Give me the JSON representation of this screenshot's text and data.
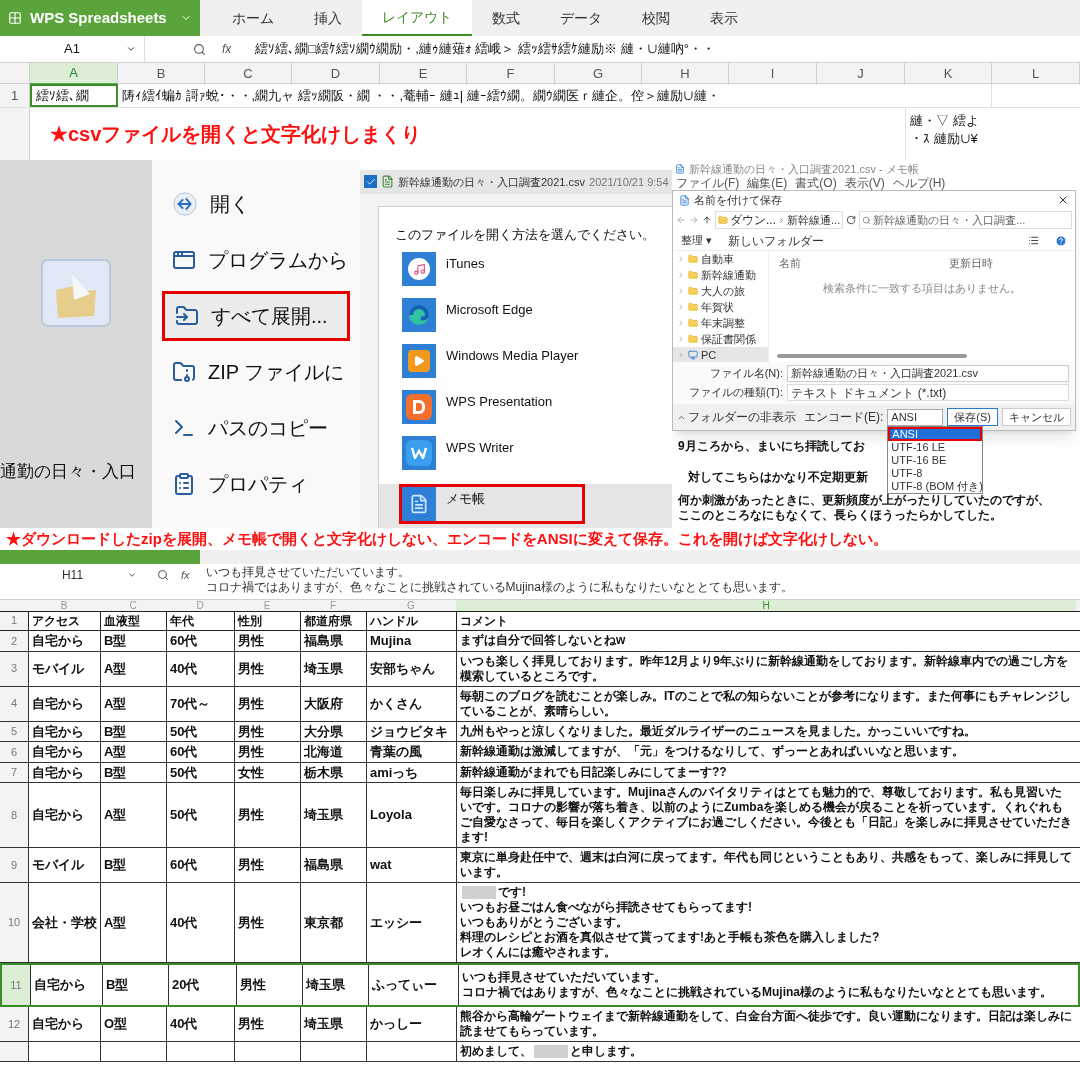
{
  "top_sheet": {
    "app_name": "WPS Spreadsheets",
    "tabs": [
      {
        "label": "ホーム",
        "selected": false
      },
      {
        "label": "挿入",
        "selected": false
      },
      {
        "label": "レイアウト",
        "selected": true
      },
      {
        "label": "数式",
        "selected": false
      },
      {
        "label": "データ",
        "selected": false
      },
      {
        "label": "校閲",
        "selected": false
      },
      {
        "label": "表示",
        "selected": false
      }
    ],
    "name_box": "A1",
    "fx": "fx",
    "formula": "繧ｿ繧､繝□繧ｹ繧ｿ繝ｳ繝励・,縺ｩ縺薙ｫ 繧峨＞ 繧ｯ繧ｻ繧ｹ縺励※ 縺・∪縺吶°・・",
    "columns": [
      {
        "label": "A",
        "selected": true
      },
      {
        "label": "B",
        "selected": false
      },
      {
        "label": "C",
        "selected": false
      },
      {
        "label": "D",
        "selected": false
      },
      {
        "label": "E",
        "selected": false
      },
      {
        "label": "F",
        "selected": false
      },
      {
        "label": "G",
        "selected": false
      },
      {
        "label": "H",
        "selected": false
      },
      {
        "label": "I",
        "selected": false
      },
      {
        "label": "J",
        "selected": false
      },
      {
        "label": "K",
        "selected": false
      },
      {
        "label": "L",
        "selected": false
      }
    ],
    "row_number": "1",
    "cell_a1": "繧ｿ繧､繝",
    "cell_b1": "陦ｨ繧ｲ蝙ｶ 謌ｧ蛻･・・,繝九ャ 繧ｯ繝阪・繝 ・・,菴輔ｰ 縺ｭ| 縺ｰ繧ｳ繝。繝ｳ繝医ｒ縺企。倥＞縺励∪縺・",
    "cell_l": [
      "縺・▽ 繧よ",
      "・ｽ 縺励∪¥"
    ],
    "caption": "★csvファイルを開くと文字化けしまくり"
  },
  "explorer": {
    "file_label": "通勤の日々・入口",
    "menu": [
      {
        "label": "開く",
        "selected": false
      },
      {
        "label": "プログラムから",
        "selected": false
      },
      {
        "label": "すべて展開...",
        "selected": true
      },
      {
        "label": "ZIP ファイルに",
        "selected": false
      },
      {
        "label": "パスのコピー",
        "selected": false
      },
      {
        "label": "プロパティ",
        "selected": false
      }
    ]
  },
  "open_with": {
    "file_checked": true,
    "file_name": "新幹線通勤の日々・入口調査2021.csv",
    "file_date": "2021/10/21 9:54",
    "title": "このファイルを開く方法を選んでください。",
    "apps": [
      {
        "label": "iTunes",
        "selected": false
      },
      {
        "label": "Microsoft Edge",
        "selected": false
      },
      {
        "label": "Windows Media Player",
        "selected": false
      },
      {
        "label": "WPS Presentation",
        "selected": false
      },
      {
        "label": "WPS Writer",
        "selected": false
      },
      {
        "label": "メモ帳",
        "selected": true
      }
    ]
  },
  "notepad": {
    "title": "新幹線通勤の日々・入口調査2021.csv - メモ帳",
    "menu": [
      "ファイル(F)",
      "編集(E)",
      "書式(O)",
      "表示(V)",
      "ヘルプ(H)"
    ],
    "save_dialog": {
      "title": "名前を付けて保存",
      "path": [
        "ダウン...",
        "新幹線通..."
      ],
      "search_placeholder": "新幹線通勤の日々・入口調査...",
      "organize": "整理 ▾",
      "new_folder": "新しいフォルダー",
      "tree": [
        {
          "label": "自動車",
          "kind": "folder",
          "selected": false
        },
        {
          "label": "新幹線通勤",
          "kind": "folder",
          "selected": false
        },
        {
          "label": "大人の旅",
          "kind": "folder",
          "selected": false
        },
        {
          "label": "年賀状",
          "kind": "folder",
          "selected": false
        },
        {
          "label": "年末調整",
          "kind": "folder",
          "selected": false
        },
        {
          "label": "保証書関係",
          "kind": "folder",
          "selected": false
        },
        {
          "label": "PC",
          "kind": "pc",
          "selected": true
        }
      ],
      "columns": [
        "名前",
        "更新日時"
      ],
      "empty_message": "検索条件に一致する項目はありません。",
      "file_name_label": "ファイル名(N):",
      "file_name": "新幹線通勤の日々・入口調査2021.csv",
      "file_type_label": "ファイルの種類(T):",
      "file_type": "テキスト ドキュメント (*.txt)",
      "hide_folders": "フォルダーの非表示",
      "encoding_label": "エンコード(E):",
      "encoding": "ANSI",
      "save": "保存(S)",
      "cancel": "キャンセル",
      "encoding_options": [
        {
          "label": "ANSI",
          "selected": true
        },
        {
          "label": "UTF-16 LE",
          "selected": false
        },
        {
          "label": "UTF-16 BE",
          "selected": false
        },
        {
          "label": "UTF-8",
          "selected": false
        },
        {
          "label": "UTF-8 (BOM 付き)",
          "selected": false
        }
      ]
    },
    "body_lines": [
      "9月ころから、まいにち拝読してお",
      "対してこちらはかなり不定期更新",
      "何か刺激があったときに、更新頻度が上がったりしていたのですが、",
      "ここのところなにもなくて、長らくほうったらかしてした。"
    ]
  },
  "caption": "★ダウンロードしたzipを展開、メモ帳で開くと文字化けしない、エンコードをANSIに変えて保存。これを開けば文字化けしない。",
  "bottom_sheet": {
    "name_box": "H11",
    "fx": "fx",
    "formula": [
      "いつも拝見させていただいています。",
      "コロナ禍ではありますが、色々なことに挑戦されているMujina様のように私もなりたいなととても思います。"
    ],
    "columns": [
      {
        "label": "B",
        "selected": false
      },
      {
        "label": "C",
        "selected": false
      },
      {
        "label": "D",
        "selected": false
      },
      {
        "label": "E",
        "selected": false
      },
      {
        "label": "F",
        "selected": false
      },
      {
        "label": "G",
        "selected": false
      },
      {
        "label": "H",
        "selected": true
      }
    ],
    "header": {
      "number": "1",
      "cells": [
        "アクセス",
        "血液型",
        "年代",
        "性別",
        "都道府県",
        "ハンドル",
        "コメント"
      ]
    },
    "rows": [
      {
        "number": "2",
        "selected": false,
        "cells": [
          "自宅から",
          "B型",
          "60代",
          "男性",
          "福島県",
          "Mujina"
        ],
        "comment": [
          "まずは自分で回答しないとねw"
        ]
      },
      {
        "number": "3",
        "selected": false,
        "cells": [
          "モバイル",
          "A型",
          "40代",
          "男性",
          "埼玉県",
          "安部ちゃん"
        ],
        "comment": [
          "いつも楽しく拝見しております。昨年12月より9年ぶりに新幹線通勤をしております。新幹線車内での過ごし方を模索しているところです。"
        ]
      },
      {
        "number": "4",
        "selected": false,
        "cells": [
          "自宅から",
          "A型",
          "70代～",
          "男性",
          "大阪府",
          "かくさん"
        ],
        "comment": [
          "毎朝このブログを読むことが楽しみ。ITのことで私の知らないことが参考になります。また何事にもチャレンジしていることが、素晴らしい。"
        ]
      },
      {
        "number": "5",
        "selected": false,
        "cells": [
          "自宅から",
          "B型",
          "50代",
          "男性",
          "大分県",
          "ジョウビタキ"
        ],
        "comment": [
          "九州もやっと涼しくなりました。最近ダルライザーのニュースを見ました。かっこいいですね。"
        ]
      },
      {
        "number": "6",
        "selected": false,
        "cells": [
          "自宅から",
          "A型",
          "60代",
          "男性",
          "北海道",
          "青葉の風"
        ],
        "comment": [
          "新幹線通勤は激減してますが、「元」をつけるなりして、ずっーとあればいいなと思います。"
        ]
      },
      {
        "number": "7",
        "selected": false,
        "cells": [
          "自宅から",
          "B型",
          "50代",
          "女性",
          "栃木県",
          "amiっち"
        ],
        "comment": [
          "新幹線通勤がまれでも日記楽しみにしてまーす??"
        ]
      },
      {
        "number": "8",
        "selected": false,
        "cells": [
          "自宅から",
          "A型",
          "50代",
          "男性",
          "埼玉県",
          "Loyola"
        ],
        "comment": [
          "毎日楽しみに拝見しています。Mujinaさんのバイタリティはとても魅力的で、尊敬しております。私も見習いたいです。コロナの影響が落ち着き、以前のようにZumbaを楽しめる機会が戻ることを祈っています。くれぐれもご自愛なさって、毎日を楽しくアクティブにお過ごしください。今後とも「日記」を楽しみに拝見させていただきます!"
        ]
      },
      {
        "number": "9",
        "selected": false,
        "cells": [
          "モバイル",
          "B型",
          "60代",
          "男性",
          "福島県",
          "wat"
        ],
        "comment": [
          "東京に単身赴任中で、週末は白河に戻ってます。年代も同じということもあり、共感をもって、楽しみに拝見しています。"
        ]
      },
      {
        "number": "10",
        "selected": false,
        "cells": [
          "会社・学校",
          "A型",
          "40代",
          "男性",
          "東京都",
          "エッシー"
        ],
        "comment": [
          {
            "parts": [
              {
                "kind": "redacted"
              },
              "です!"
            ]
          },
          "いつもお昼ごはん食べながら拝読させてもらってます!",
          "いつもありがとうございます。",
          "料理のレシピとお酒を真似させて貰ってます!あと手帳も茶色を購入しました?",
          "レオくんには癒やされます。"
        ]
      },
      {
        "number": "11",
        "selected": true,
        "cells": [
          "自宅から",
          "B型",
          "20代",
          "男性",
          "埼玉県",
          "ふってぃー"
        ],
        "comment": [
          "いつも拝見させていただいています。",
          "コロナ禍ではありますが、色々なことに挑戦されているMujina様のように私もなりたいなととても思います。"
        ]
      },
      {
        "number": "12",
        "selected": false,
        "cells": [
          "自宅から",
          "O型",
          "40代",
          "男性",
          "埼玉県",
          "かっしー"
        ],
        "comment": [
          "熊谷から高輪ゲートウェイまで新幹線通勤をして、白金台方面へ徒歩です。良い運動になります。日記は楽しみに読ませてもらっています。"
        ]
      },
      {
        "selected": false,
        "comment": [
          {
            "parts": [
              "初めまして、",
              {
                "kind": "redacted"
              },
              "と申します。"
            ]
          }
        ]
      }
    ]
  }
}
